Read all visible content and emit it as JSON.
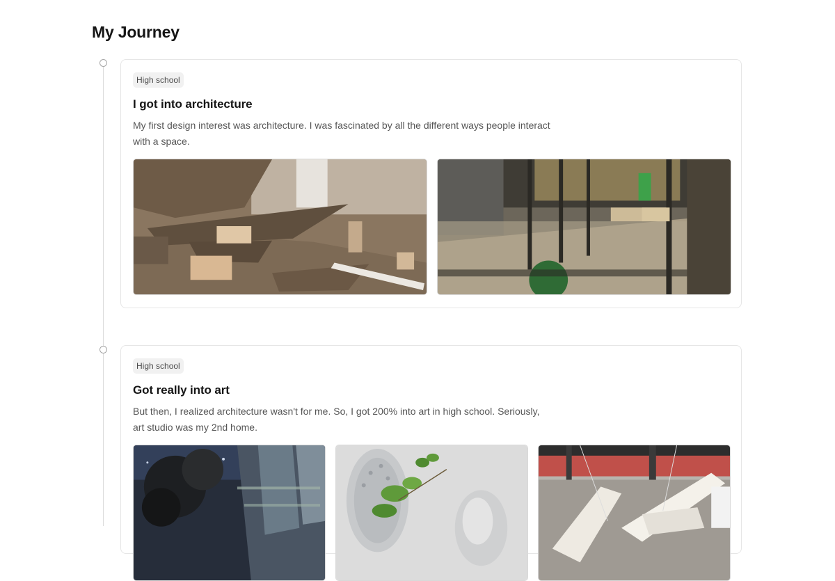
{
  "page": {
    "title": "My Journey"
  },
  "entries": [
    {
      "tag": "High school",
      "title": "I got into architecture",
      "description": "My first design interest was architecture. I was fascinated by all the different ways people interact with a space.",
      "photos": [
        "architecture-model-photo",
        "interior-model-photo"
      ]
    },
    {
      "tag": "High school",
      "title": "Got really into art",
      "description": "But then, I realized architecture wasn't for me. So, I got 200% into art in high school. Seriously, art studio was my 2nd home.",
      "photos": [
        "night-city-painting-photo",
        "plant-sculpture-photo",
        "white-sculpture-photo"
      ]
    }
  ],
  "colors": {
    "timeline_line": "#dcdcdc",
    "timeline_dot": "#a5a5a5",
    "card_border": "#e6e6e6",
    "tag_background": "#f1f1f1"
  }
}
